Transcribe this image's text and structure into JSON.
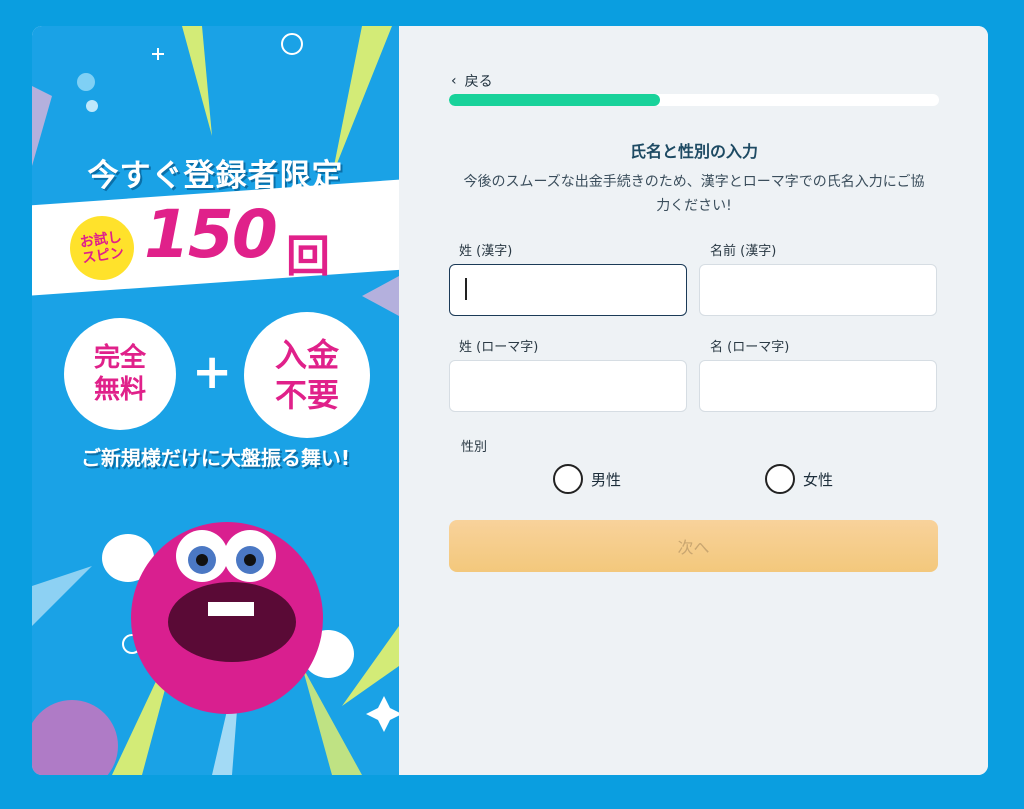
{
  "promo": {
    "headline": "今すぐ登録者限定",
    "trial_badge_line1": "お試し",
    "trial_badge_line2": "スピン",
    "spin_count": "150",
    "spin_unit": "回",
    "free_badge_line1": "完全",
    "free_badge_line2": "無料",
    "plus": "+",
    "deposit_badge_line1": "入金",
    "deposit_badge_line2": "不要",
    "tagline": "ご新規様だけに大盤振る舞い!"
  },
  "form": {
    "back_label": "戻る",
    "progress": 0.43,
    "title": "氏名と性別の入力",
    "subtitle_line1": "今後のスムーズな出金手続きのため、漢字とローマ字での氏名入力にご協",
    "subtitle_line2": "力ください!",
    "fields": {
      "last_kanji_label": "姓 (漢字)",
      "first_kanji_label": "名前 (漢字)",
      "last_roman_label": "姓 (ローマ字)",
      "first_roman_label": "名 (ローマ字)"
    },
    "gender_label": "性別",
    "gender_male": "男性",
    "gender_female": "女性",
    "next_label": "次へ"
  },
  "colors": {
    "page_bg": "#0a9ee0",
    "promo_bg": "#1aa2e6",
    "accent_pink": "#e0218a",
    "progress_fill": "#18d29a",
    "next_button": "#f6ce8c"
  }
}
